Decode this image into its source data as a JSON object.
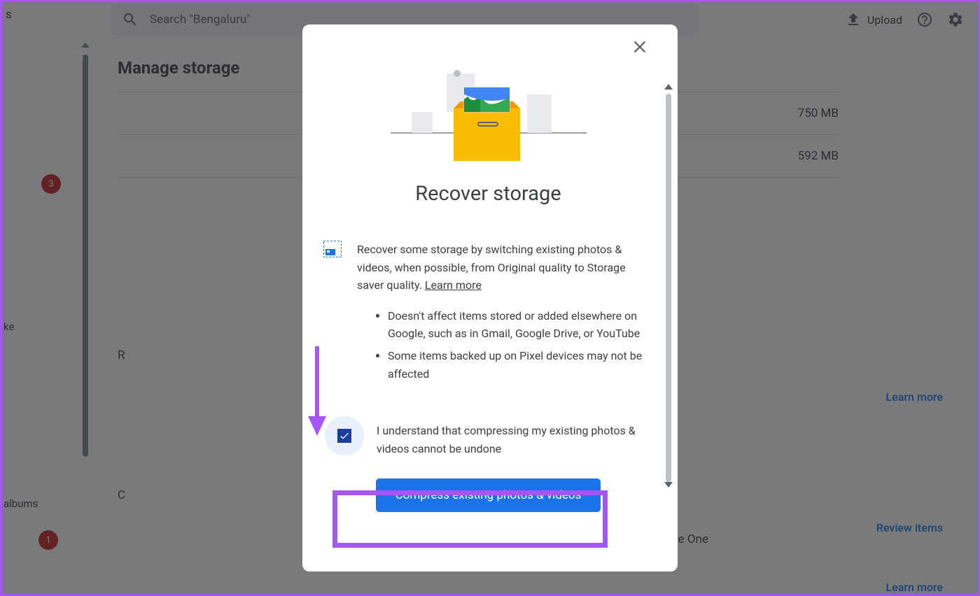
{
  "search": {
    "placeholder": "Search \"Bengaluru\""
  },
  "topbar": {
    "upload": "Upload"
  },
  "sidebar": {
    "badge1": "3",
    "badge2": "1",
    "text1": "ke",
    "text2": "s",
    "text3": "albums"
  },
  "page": {
    "title": "Manage storage",
    "storage1": "750 MB",
    "storage2": "592 MB",
    "section_r": "R",
    "section_c": "C",
    "learn_more1": "Learn more",
    "review_items": "Review items",
    "learn_more2": "Learn more",
    "google_one": "Google One"
  },
  "modal": {
    "title": "Recover storage",
    "info_text": "Recover some storage by switching existing photos & videos, when possible, from Original quality to Storage saver quality. ",
    "learn_more": "Learn more",
    "bullet1": "Doesn't affect items stored or added elsewhere on Google, such as in Gmail, Google Drive, or YouTube",
    "bullet2": "Some items backed up on Pixel devices may not be affected",
    "checkbox_label": "I understand that compressing my existing photos & videos cannot be undone",
    "compress_btn": "Compress existing photos & videos"
  }
}
